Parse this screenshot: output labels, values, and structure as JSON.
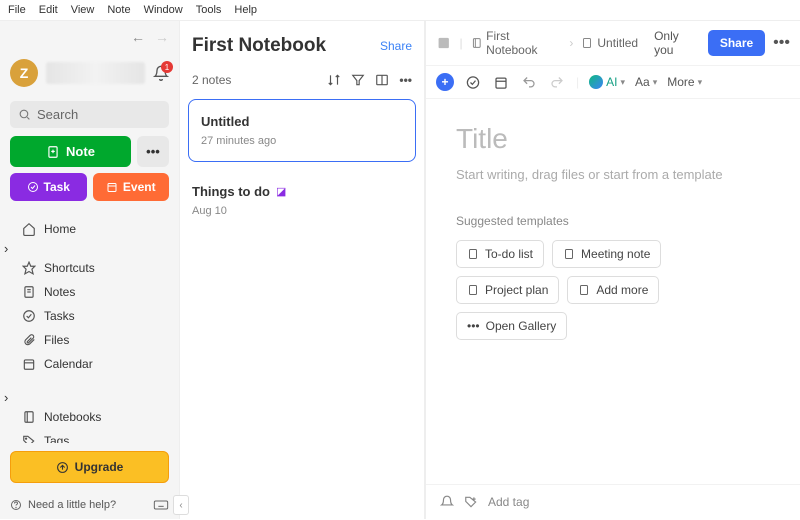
{
  "menubar": [
    "File",
    "Edit",
    "View",
    "Note",
    "Window",
    "Tools",
    "Help"
  ],
  "sidebar": {
    "avatar_initial": "Z",
    "notification_count": "1",
    "search_placeholder": "Search",
    "btn_note": "Note",
    "btn_task": "Task",
    "btn_event": "Event",
    "nav": [
      {
        "icon": "home",
        "label": "Home"
      },
      {
        "icon": "star",
        "label": "Shortcuts",
        "expandable": true
      },
      {
        "icon": "note",
        "label": "Notes"
      },
      {
        "icon": "check",
        "label": "Tasks"
      },
      {
        "icon": "clip",
        "label": "Files"
      },
      {
        "icon": "calendar",
        "label": "Calendar"
      }
    ],
    "nav2": [
      {
        "icon": "notebook",
        "label": "Notebooks",
        "expandable": true
      },
      {
        "icon": "tag",
        "label": "Tags"
      }
    ],
    "upgrade": "Upgrade",
    "help": "Need a little help?"
  },
  "notelist": {
    "title": "First Notebook",
    "share": "Share",
    "count": "2 notes",
    "notes": [
      {
        "title": "Untitled",
        "time": "27 minutes ago",
        "selected": true
      },
      {
        "title": "Things to do",
        "time": "Aug 10",
        "task_icon": true
      }
    ]
  },
  "editor": {
    "crumb_notebook": "First Notebook",
    "crumb_note": "Untitled",
    "only_you": "Only you",
    "share": "Share",
    "ai_label": "AI",
    "aa_label": "Aa",
    "more_label": "More",
    "title_placeholder": "Title",
    "body_placeholder": "Start writing, drag files or start from a template",
    "templates_label": "Suggested templates",
    "templates": [
      "To-do list",
      "Meeting note",
      "Project plan",
      "Add more",
      "Open Gallery"
    ],
    "add_tag": "Add tag"
  }
}
